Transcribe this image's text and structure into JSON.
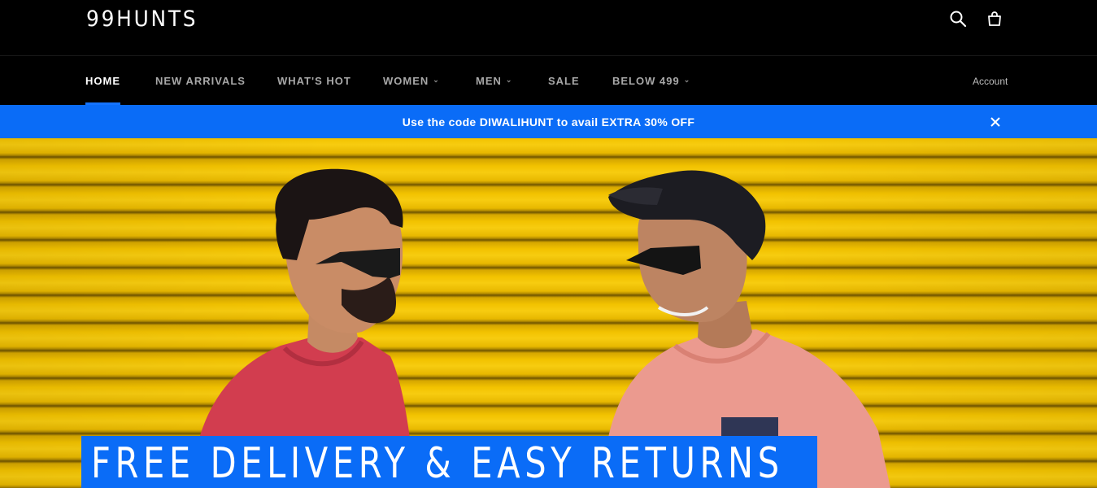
{
  "header": {
    "logo": "99HUNTS",
    "icons": [
      "search-icon",
      "cart-icon"
    ]
  },
  "nav": {
    "items": [
      {
        "label": "HOME",
        "active": true
      },
      {
        "label": "NEW ARRIVALS"
      },
      {
        "label": "WHAT'S HOT"
      },
      {
        "label": "WOMEN",
        "dropdown": true
      },
      {
        "label": "MEN",
        "dropdown": true
      },
      {
        "label": "SALE"
      },
      {
        "label": "BELOW 499",
        "dropdown": true
      }
    ],
    "account": "Account"
  },
  "announcement": {
    "text": "Use the code DIWALIHUNT to avail EXTRA 30% OFF",
    "close_icon": "close-icon"
  },
  "hero": {
    "banner": "FREE DELIVERY & EASY RETURNS"
  },
  "colors": {
    "accent": "#0a6cf7",
    "header_bg": "#000000",
    "hero_bg": "#f2c200"
  }
}
